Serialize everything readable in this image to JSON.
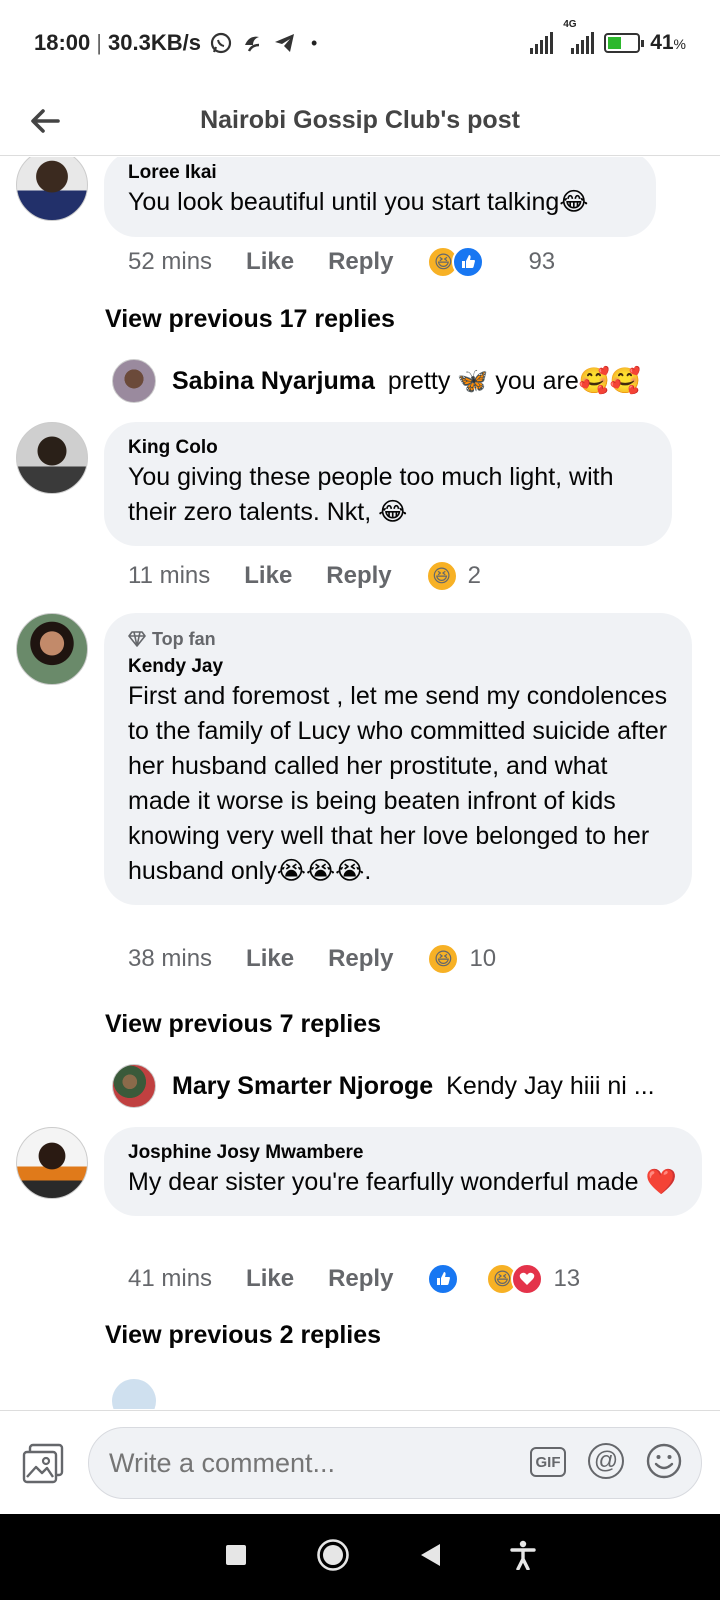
{
  "status_bar": {
    "time": "18:00",
    "speed": "30.3KB/s",
    "network": "4G",
    "battery": "41",
    "battery_unit": "%",
    "battery_level": 0.41
  },
  "header": {
    "title": "Nairobi Gossip Club's post"
  },
  "comments": [
    {
      "author": "Loree Ikai",
      "text": "You look beautiful until you start talking😂",
      "time": "52 mins",
      "like": "Like",
      "reply": "Reply",
      "reactions": [
        "haha",
        "like"
      ],
      "count": "93"
    },
    {
      "author": "King Colo",
      "text": "You giving these people too much light, with their zero talents. Nkt, 😂",
      "time": "11 mins",
      "like": "Like",
      "reply": "Reply",
      "reactions": [
        "haha"
      ],
      "count": "2"
    },
    {
      "badge": "Top fan",
      "author": "Kendy Jay",
      "text": "First and foremost , let me send my condolences to the family of Lucy who committed suicide after her husband called her prostitute, and what made it worse is being beaten infront of kids knowing very well that her love belonged to her husband only😭😭😭.",
      "time": "38 mins",
      "like": "Like",
      "reply": "Reply",
      "reactions": [
        "haha"
      ],
      "count": "10"
    },
    {
      "author": "Josphine Josy Mwambere",
      "text": "My dear sister you're fearfully wonderful made ❤️",
      "time": "41 mins",
      "like": "Like",
      "reply": "Reply",
      "reactions": [
        "like",
        "haha",
        "love"
      ],
      "count": "13"
    }
  ],
  "view_previous": [
    "View previous 17 replies",
    "View previous 7 replies",
    "View previous 2 replies"
  ],
  "reply_previews": [
    {
      "name": "Sabina Nyarjuma",
      "snippet": "pretty 🦋 you are🥰🥰"
    },
    {
      "name": "Mary Smarter Njoroge",
      "snippet": "Kendy Jay hiii ni ..."
    }
  ],
  "composer": {
    "placeholder": "Write a comment...",
    "gif_label": "GIF",
    "mention_label": "@"
  },
  "colors": {
    "bubble": "#f0f2f5",
    "like_blue": "#1877f2",
    "haha_yellow": "#f7b125",
    "love_red": "#e4334a",
    "meta_gray": "#65676b"
  },
  "icons": [
    "back-arrow-icon",
    "photo-icon",
    "gif-icon",
    "mention-icon",
    "emoji-icon",
    "recents-nav-icon",
    "home-nav-icon",
    "back-nav-icon",
    "accessibility-icon"
  ]
}
